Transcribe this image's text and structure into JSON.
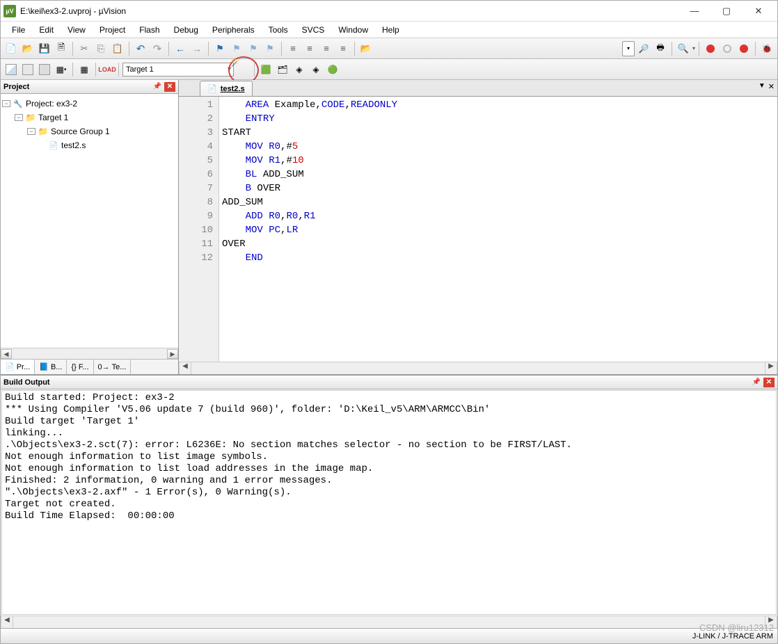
{
  "window": {
    "title": "E:\\keil\\ex3-2.uvproj - µVision",
    "app_icon_text": "µV"
  },
  "menus": [
    "File",
    "Edit",
    "View",
    "Project",
    "Flash",
    "Debug",
    "Peripherals",
    "Tools",
    "SVCS",
    "Window",
    "Help"
  ],
  "toolbar2": {
    "target_label": "Target 1"
  },
  "project_panel": {
    "title": "Project",
    "root": "Project: ex3-2",
    "target": "Target 1",
    "group": "Source Group 1",
    "file": "test2.s"
  },
  "project_tabs": {
    "t1": "Pr...",
    "t2": "B...",
    "t3": "F...",
    "t4": "Te..."
  },
  "editor": {
    "tab_filename": "test2.s",
    "lines": [
      {
        "n": 1,
        "segments": [
          {
            "t": "    "
          },
          {
            "t": "AREA",
            "c": "kw"
          },
          {
            "t": " Example,"
          },
          {
            "t": "CODE",
            "c": "kw"
          },
          {
            "t": ","
          },
          {
            "t": "READONLY",
            "c": "kw"
          }
        ]
      },
      {
        "n": 2,
        "segments": [
          {
            "t": "    "
          },
          {
            "t": "ENTRY",
            "c": "kw"
          }
        ]
      },
      {
        "n": 3,
        "segments": [
          {
            "t": "START"
          }
        ]
      },
      {
        "n": 4,
        "segments": [
          {
            "t": "    "
          },
          {
            "t": "MOV",
            "c": "kw"
          },
          {
            "t": " "
          },
          {
            "t": "R0",
            "c": "kw"
          },
          {
            "t": ",#"
          },
          {
            "t": "5",
            "c": "num"
          }
        ]
      },
      {
        "n": 5,
        "segments": [
          {
            "t": "    "
          },
          {
            "t": "MOV",
            "c": "kw"
          },
          {
            "t": " "
          },
          {
            "t": "R1",
            "c": "kw"
          },
          {
            "t": ",#"
          },
          {
            "t": "10",
            "c": "num"
          }
        ]
      },
      {
        "n": 6,
        "segments": [
          {
            "t": "    "
          },
          {
            "t": "BL",
            "c": "kw"
          },
          {
            "t": " ADD_SUM"
          }
        ]
      },
      {
        "n": 7,
        "segments": [
          {
            "t": "    "
          },
          {
            "t": "B",
            "c": "kw"
          },
          {
            "t": " OVER"
          }
        ]
      },
      {
        "n": 8,
        "segments": [
          {
            "t": "ADD_SUM"
          }
        ]
      },
      {
        "n": 9,
        "segments": [
          {
            "t": "    "
          },
          {
            "t": "ADD",
            "c": "kw"
          },
          {
            "t": " "
          },
          {
            "t": "R0",
            "c": "kw"
          },
          {
            "t": ","
          },
          {
            "t": "R0",
            "c": "kw"
          },
          {
            "t": ","
          },
          {
            "t": "R1",
            "c": "kw"
          }
        ]
      },
      {
        "n": 10,
        "segments": [
          {
            "t": "    "
          },
          {
            "t": "MOV",
            "c": "kw"
          },
          {
            "t": " "
          },
          {
            "t": "PC",
            "c": "kw"
          },
          {
            "t": ","
          },
          {
            "t": "LR",
            "c": "kw"
          }
        ]
      },
      {
        "n": 11,
        "segments": [
          {
            "t": "OVER"
          }
        ]
      },
      {
        "n": 12,
        "segments": [
          {
            "t": "    "
          },
          {
            "t": "END",
            "c": "kw"
          }
        ]
      }
    ]
  },
  "build_output": {
    "title": "Build Output",
    "lines": [
      "Build started: Project: ex3-2",
      "*** Using Compiler 'V5.06 update 7 (build 960)', folder: 'D:\\Keil_v5\\ARM\\ARMCC\\Bin'",
      "Build target 'Target 1'",
      "linking...",
      ".\\Objects\\ex3-2.sct(7): error: L6236E: No section matches selector - no section to be FIRST/LAST.",
      "Not enough information to list image symbols.",
      "Not enough information to list load addresses in the image map.",
      "Finished: 2 information, 0 warning and 1 error messages.",
      "\".\\Objects\\ex3-2.axf\" - 1 Error(s), 0 Warning(s).",
      "Target not created.",
      "Build Time Elapsed:  00:00:00"
    ]
  },
  "statusbar": {
    "debugger": "J-LINK / J-TRACE ARM"
  },
  "watermark": "CSDN @liru12312"
}
